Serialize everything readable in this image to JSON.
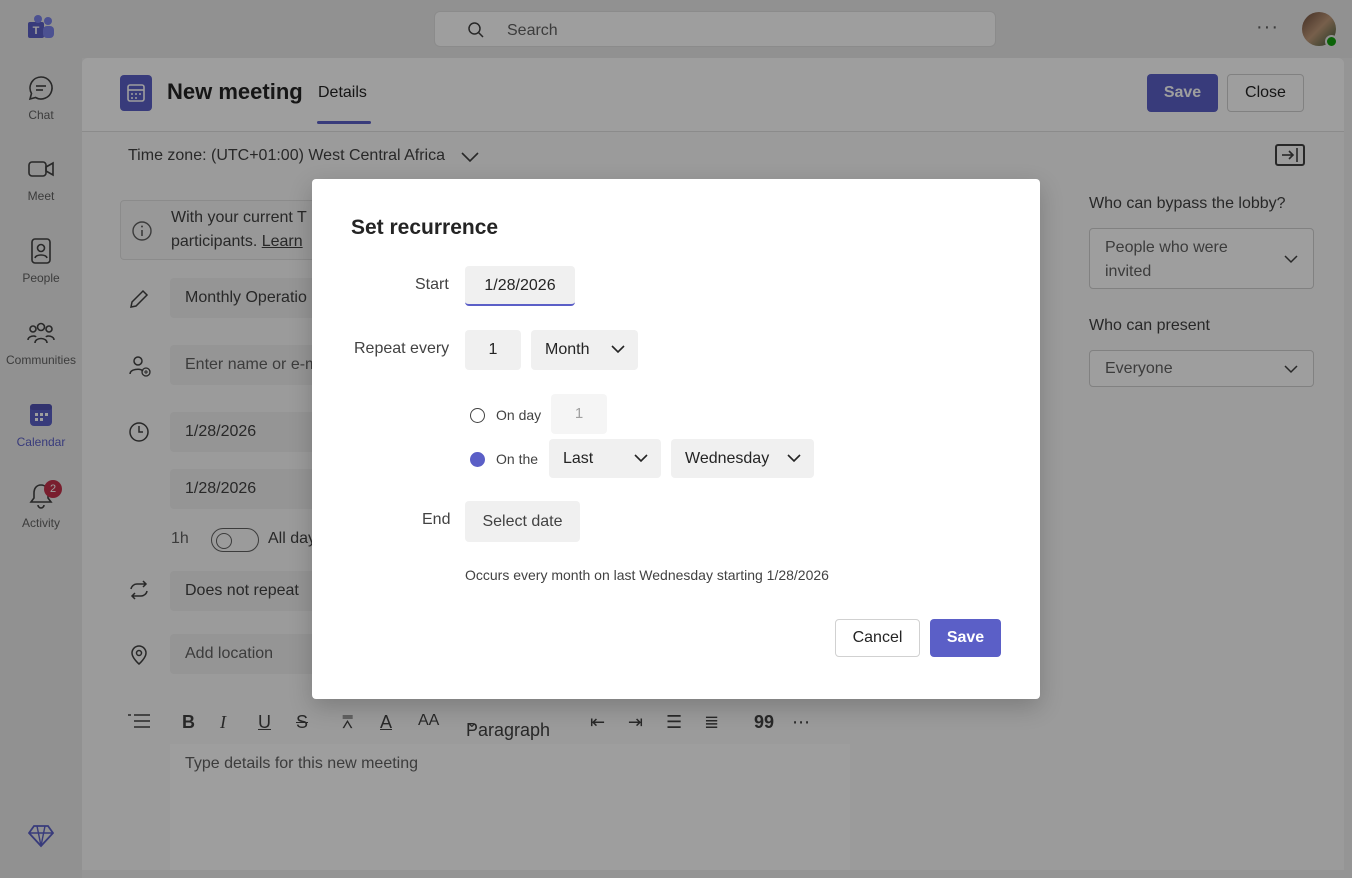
{
  "topbar": {
    "search_placeholder": "Search",
    "more_label": "···"
  },
  "rail": {
    "items": [
      {
        "label": "Chat",
        "icon": "chat-icon"
      },
      {
        "label": "Meet",
        "icon": "video-icon"
      },
      {
        "label": "People",
        "icon": "people-icon"
      },
      {
        "label": "Communities",
        "icon": "communities-icon"
      },
      {
        "label": "Calendar",
        "icon": "calendar-icon",
        "active": true
      },
      {
        "label": "Activity",
        "icon": "bell-icon",
        "badge": "2"
      }
    ]
  },
  "header": {
    "title": "New meeting",
    "tab": "Details",
    "save_label": "Save",
    "close_label": "Close"
  },
  "timezone": "Time zone: (UTC+01:00) West Central Africa",
  "info": {
    "line1": "With your current T",
    "line2_prefix": "participants.",
    "line2_link": "Learn"
  },
  "form": {
    "title_value": "Monthly Operatio",
    "attendees_placeholder": "Enter name or e-m",
    "start_date": "1/28/2026",
    "end_date": "1/28/2026",
    "duration": "1h",
    "allday_label": "All day",
    "repeat_value": "Does not repeat",
    "location_placeholder": "Add location",
    "editor_paragraph": "Paragraph",
    "editor_placeholder": "Type details for this new meeting"
  },
  "right": {
    "lobby_label": "Who can bypass the lobby?",
    "lobby_value_line1": "People who were",
    "lobby_value_line2": "invited",
    "present_label": "Who can present",
    "present_value": "Everyone"
  },
  "dialog": {
    "title": "Set recurrence",
    "start_label": "Start",
    "start_value": "1/28/2026",
    "repeat_label": "Repeat every",
    "repeat_count": "1",
    "repeat_unit": "Month",
    "on_day_label": "On day",
    "on_day_value": "1",
    "on_the_label": "On the",
    "ordinal": "Last",
    "weekday": "Wednesday",
    "end_label": "End",
    "end_placeholder": "Select date",
    "summary": "Occurs every month on last Wednesday starting 1/28/2026",
    "cancel_label": "Cancel",
    "save_label": "Save"
  },
  "colors": {
    "accent": "#5b5fc7",
    "badge": "#c4314b",
    "presence": "#13a10e"
  }
}
